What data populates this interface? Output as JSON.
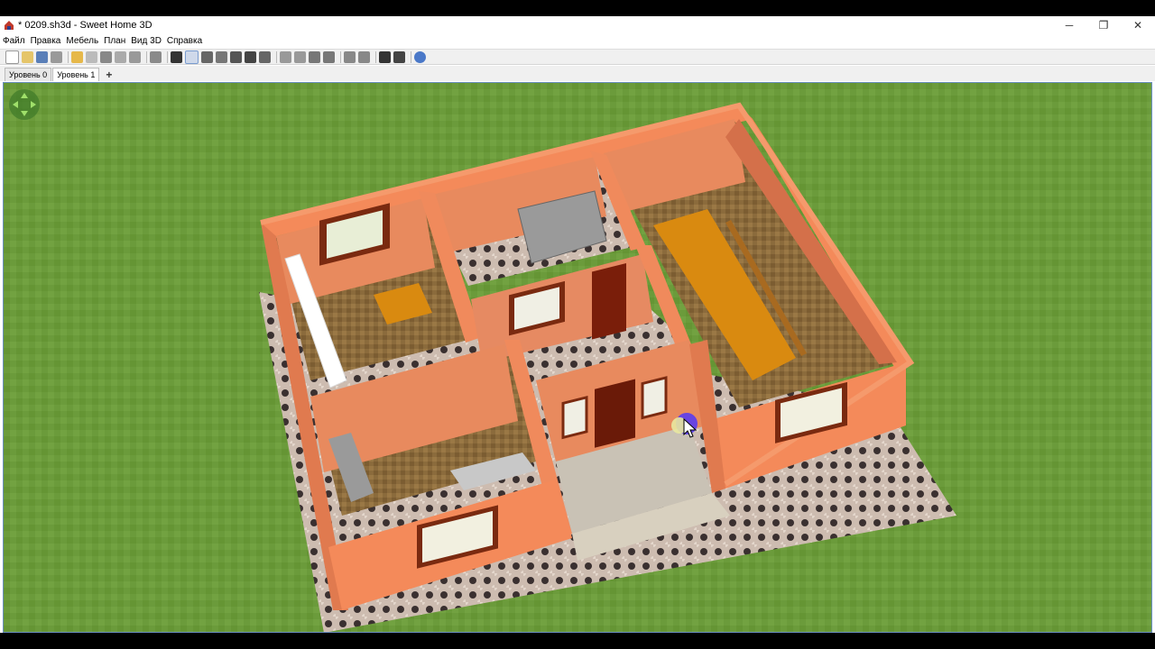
{
  "window": {
    "title": "* 0209.sh3d - Sweet Home 3D",
    "controls": {
      "minimize": "─",
      "maximize": "❐",
      "close": "✕"
    }
  },
  "menu": {
    "items": [
      "Файл",
      "Правка",
      "Мебель",
      "План",
      "Вид 3D",
      "Справка"
    ]
  },
  "toolbar": {
    "icons": [
      "new-icon",
      "open-icon",
      "save-icon",
      "cut-icon",
      "separator",
      "undo-icon",
      "redo-icon",
      "scissors-icon",
      "copy-icon",
      "paste-icon",
      "separator",
      "add-furniture-icon",
      "separator",
      "select-icon",
      "pan-icon",
      "create-walls-icon",
      "create-rooms-icon",
      "create-polylines-icon",
      "create-dimensions-icon",
      "add-text-icon",
      "separator",
      "increase-text-icon",
      "decrease-text-icon",
      "bold-icon",
      "italic-icon",
      "separator",
      "zoom-in-icon",
      "zoom-out-icon",
      "separator",
      "photo-icon",
      "video-icon",
      "separator",
      "help-icon"
    ]
  },
  "levels": {
    "tabs": [
      "Уровень 0",
      "Уровень 1"
    ],
    "active": 1,
    "add_label": "+"
  },
  "colors": {
    "grass": "#6a9a3a",
    "wall": "#e8845a",
    "wall_top": "#f48a5a",
    "floor_wood": "#8a6a3a",
    "table": "#d98a10",
    "accent_border": "#6a8fbf"
  }
}
